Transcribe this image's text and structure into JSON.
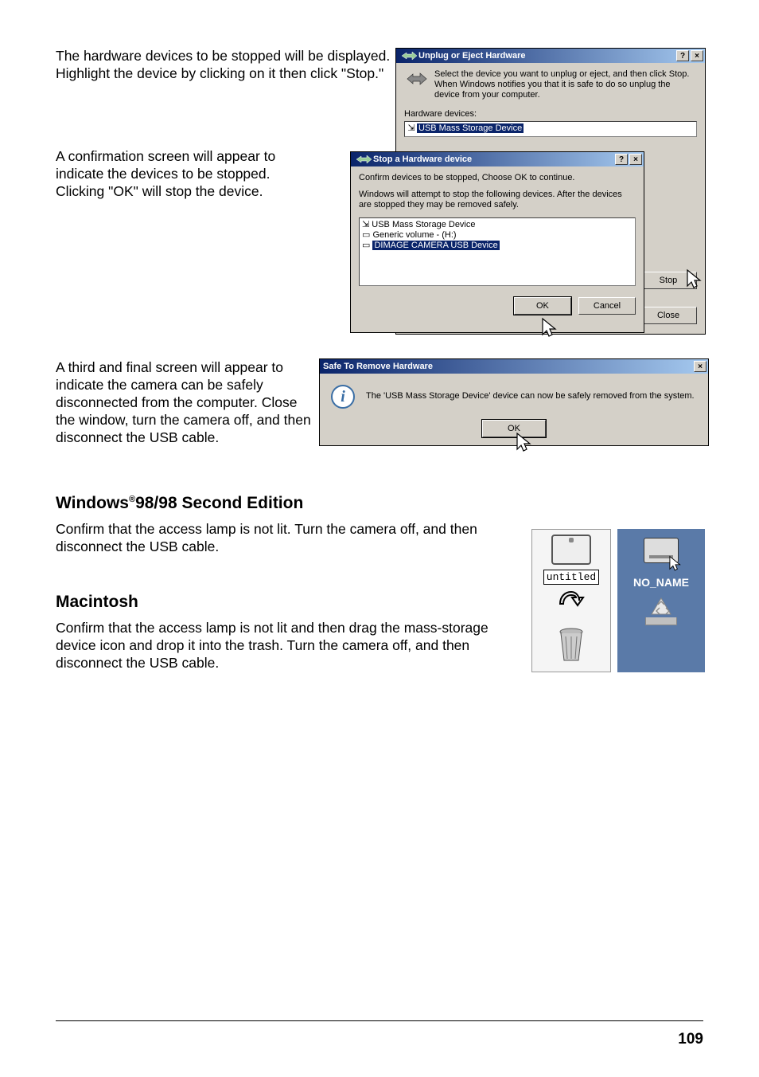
{
  "step1": {
    "text": "The hardware devices to be stopped will be displayed. Highlight the device by clicking on it then click \"Stop.\""
  },
  "step2": {
    "text": "A confirmation screen will appear to indicate the devices to be stopped. Clicking \"OK\" will stop the device."
  },
  "step3": {
    "text": "A third and final screen will appear to indicate the camera can be safely disconnected from the computer. Close the window, turn the camera off, and then disconnect the USB cable."
  },
  "win98": {
    "heading_prefix": "Windows",
    "heading_reg": "®",
    "heading_rest": "98/98 Second Edition",
    "text": "Confirm that the access lamp is not lit. Turn the camera off, and then disconnect the USB cable."
  },
  "mac": {
    "heading": "Macintosh",
    "text": "Confirm that the access lamp is not lit and then drag the mass-storage device icon and drop it into the trash. Turn the camera off, and then disconnect the USB cable."
  },
  "unplug_dialog": {
    "title": "Unplug or Eject Hardware",
    "help_btn": "?",
    "close_btn": "×",
    "instructions": "Select the device you want to unplug or eject, and then click Stop. When Windows notifies you that it is safe to do so unplug the device from your computer.",
    "list_label": "Hardware devices:",
    "selected_item": "USB Mass Storage Device",
    "stop_btn": "Stop",
    "close_btn_label": "Close"
  },
  "stop_dialog": {
    "title": "Stop a Hardware device",
    "help_btn": "?",
    "close_btn": "×",
    "line1": "Confirm devices to be stopped, Choose OK to continue.",
    "line2": "Windows will attempt to stop the following devices. After the devices are stopped they may be removed safely.",
    "items": [
      "USB Mass Storage Device",
      "Generic volume - (H:)",
      "DIMAGE CAMERA USB Device"
    ],
    "ok_btn": "OK",
    "cancel_btn": "Cancel"
  },
  "safe_dialog": {
    "title": "Safe To Remove Hardware",
    "close_btn": "×",
    "message": "The 'USB Mass Storage Device' device can now be safely removed from the system.",
    "ok_btn": "OK"
  },
  "drive_icons": {
    "mac_label": "untitled",
    "win_label": "NO_NAME"
  },
  "page_number": "109"
}
